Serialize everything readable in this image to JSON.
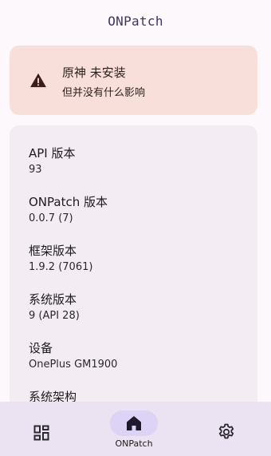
{
  "app": {
    "title": "ONPatch"
  },
  "warning": {
    "title": "原神 未安装",
    "subtitle": "但并没有什么影响",
    "icon": "warning-triangle-icon",
    "color": "#f9dfd9"
  },
  "info": {
    "items": [
      {
        "label": "API 版本",
        "value": "93"
      },
      {
        "label": "ONPatch 版本",
        "value": "0.0.7 (7)"
      },
      {
        "label": "框架版本",
        "value": "1.9.2 (7061)"
      },
      {
        "label": "系统版本",
        "value": "9 (API 28)"
      },
      {
        "label": "设备",
        "value": "OnePlus GM1900"
      },
      {
        "label": "系统架构",
        "value": ""
      }
    ]
  },
  "nav": {
    "items": [
      {
        "label": "",
        "icon": "dashboard-icon"
      },
      {
        "label": "ONPatch",
        "icon": "home-icon",
        "selected": true
      },
      {
        "label": "",
        "icon": "gear-icon"
      }
    ]
  }
}
